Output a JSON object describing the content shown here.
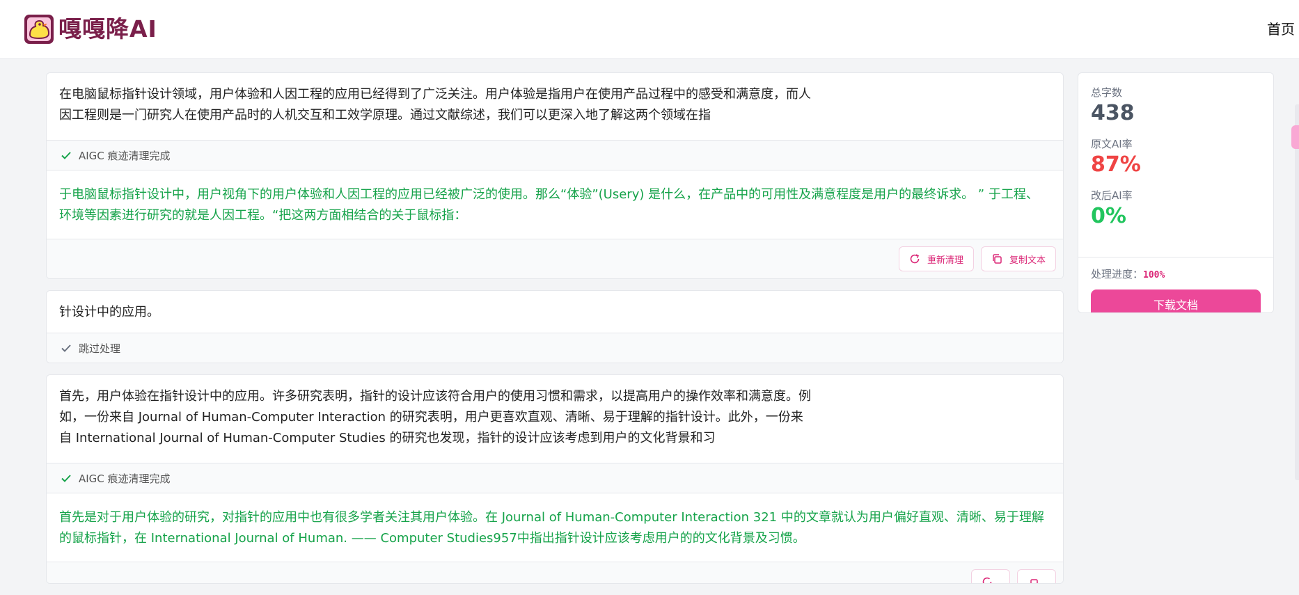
{
  "header": {
    "logo_text": "嘎嘎降AI",
    "nav_home": "首页"
  },
  "segments": [
    {
      "original": "在电脑鼠标指针设计领域，用户体验和人因工程的应用已经得到了广泛关注。用户体验是指用户在使用产品过程中的感受和满意度，而人因工程则是一门研究人在使用产品时的人机交互和工效学原理。通过文献综述，我们可以更深入地了解这两个领域在指",
      "status": "AIGC 痕迹清理完成",
      "result": "于电脑鼠标指针设计中，用户视角下的用户体验和人因工程的应用已经被广泛的使用。那么“体验”(Usery) 是什么，在产品中的可用性及满意程度是用户的最终诉求。 ” 于工程、环境等因素进行研究的就是人因工程。“把这两方面相结合的关于鼠标指：",
      "actions": {
        "retry": "重新清理",
        "copy": "复制文本"
      }
    },
    {
      "original": "针设计中的应用。",
      "status": "跳过处理"
    },
    {
      "original": "首先，用户体验在指针设计中的应用。许多研究表明，指针的设计应该符合用户的使用习惯和需求，以提高用户的操作效率和满意度。例如，一份来自 Journal of Human-Computer Interaction 的研究表明，用户更喜欢直观、清晰、易于理解的指针设计。此外，一份来自 International Journal of Human-Computer Studies 的研究也发现，指针的设计应该考虑到用户的文化背景和习",
      "status": "AIGC 痕迹清理完成",
      "result": "首先是对于用户体验的研究，对指针的应用中也有很多学者关注其用户体验。在 Journal of Human-Computer Interaction 321 中的文章就认为用户偏好直观、清晰、易于理解的鼠标指针，在 International Journal of Human. —— Computer Studies957中指出指针设计应该考虑用户的的文化背景及习惯。"
    }
  ],
  "sidebar": {
    "total_label": "总字数",
    "total_value": "438",
    "orig_ai_label": "原文AI率",
    "orig_ai_value": "87%",
    "new_ai_label": "改后AI率",
    "new_ai_value": "0%",
    "progress_label": "处理进度：",
    "progress_value": "100%",
    "download_label": "下载文档"
  },
  "colors": {
    "brand_pink": "#ec4899",
    "result_green": "#16a34a",
    "ai_red": "#ef4444",
    "ai_green": "#22c55e"
  },
  "icons": [
    "logo-duck-icon",
    "check-icon",
    "refresh-icon",
    "copy-icon"
  ]
}
